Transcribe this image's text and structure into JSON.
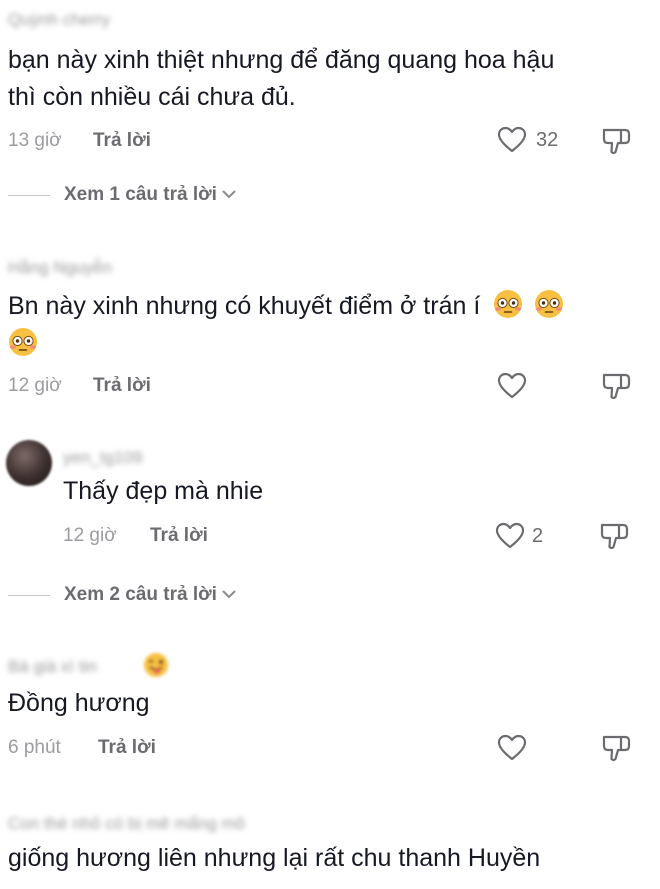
{
  "comments": [
    {
      "username": "Quỳnh cherry",
      "text_lines": [
        "bạn này xinh thiệt nhưng để đăng quang hoa hậu",
        "thì còn nhiều cái chưa đủ."
      ],
      "time": "13 giờ",
      "reply_label": "Trả lời",
      "likes": "32",
      "view_replies": "Xem 1 câu trả lời"
    },
    {
      "username": "Hằng Nguyễn",
      "text_lines": [
        "Bn này xinh nhưng có khuyết điểm ở trán í"
      ],
      "emoji": "flushed-face",
      "time": "12 giờ",
      "reply_label": "Trả lời",
      "likes": ""
    },
    {
      "username": "yen_tg109",
      "text_lines": [
        "Thấy đẹp mà nhie"
      ],
      "time": "12 giờ",
      "reply_label": "Trả lời",
      "likes": "2",
      "view_replies": "Xem 2 câu trả lời"
    },
    {
      "username": "Bà già xì tin",
      "text_lines": [
        "Đồng hương"
      ],
      "time": "6 phút",
      "reply_label": "Trả lời",
      "likes": ""
    },
    {
      "username": "Con thè nhỏ có bị mê mẩng mô",
      "text_lines": [
        "giống hương liên nhưng lại rất chu thanh Huyền"
      ]
    }
  ],
  "colors": {
    "text": "#161823",
    "meta": "#9b9ba0",
    "icon": "#6b6b70"
  },
  "icons": {
    "like": "heart-outline-icon",
    "dislike": "thumbs-down-icon",
    "expand": "chevron-down-icon"
  }
}
